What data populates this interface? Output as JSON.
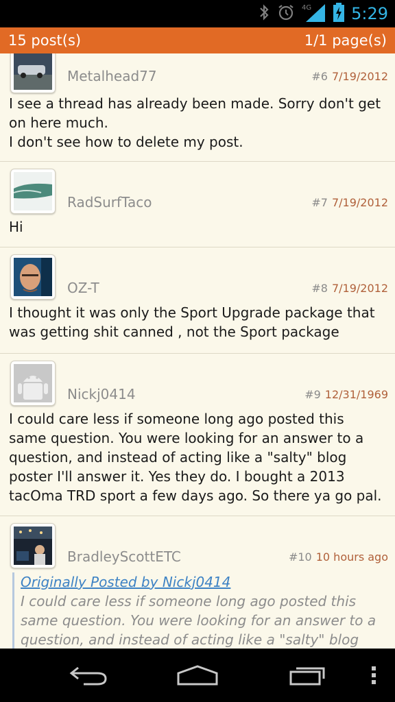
{
  "status_bar": {
    "time": "5:29",
    "network": "4G",
    "icons": [
      "bluetooth-icon",
      "alarm-icon",
      "signal-icon",
      "battery-charging-icon"
    ],
    "color": "#33b5e5"
  },
  "header": {
    "posts_count": "15 post(s)",
    "pages": "1/1 page(s)",
    "color": "#e16a25"
  },
  "posts": [
    {
      "username": "Metalhead77",
      "number": "#6",
      "date": "7/19/2012",
      "lines": [
        "I see a thread has already been made. Sorry don't get",
        "on here much.",
        "I don't see how to delete my post."
      ],
      "avatar": "car-photo"
    },
    {
      "username": "RadSurfTaco",
      "number": "#7",
      "date": "7/19/2012",
      "lines": [
        "Hi"
      ],
      "avatar": "wave-photo"
    },
    {
      "username": "OZ-T",
      "number": "#8",
      "date": "7/19/2012",
      "lines": [
        "I thought it was only the Sport Upgrade package that",
        "was getting shit canned , not the Sport package"
      ],
      "avatar": "face-photo"
    },
    {
      "username": "Nickj0414",
      "number": "#9",
      "date": "12/31/1969",
      "lines": [
        "I could care less if someone long ago posted this",
        "same question. You were looking for an answer to a",
        "question, and instead of acting like a \"salty\" blog",
        "poster I'll answer it. Yes they do. I bought a 2013",
        "tacOma TRD sport a few days ago. So there ya go pal."
      ],
      "avatar": "android-default"
    },
    {
      "username": "BradleyScottETC",
      "number": "#10",
      "date": "10 hours ago",
      "avatar": "night-photo",
      "quote": {
        "link": "Originally Posted by Nickj0414",
        "lines": [
          "I could care less if someone long ago posted this",
          "same question. You were looking for an answer to a",
          "question, and instead of acting like a \"salty\" blog"
        ]
      }
    }
  ],
  "nav_bar": {
    "buttons": [
      "back-icon",
      "home-icon",
      "recent-apps-icon",
      "overflow-menu-icon"
    ]
  }
}
